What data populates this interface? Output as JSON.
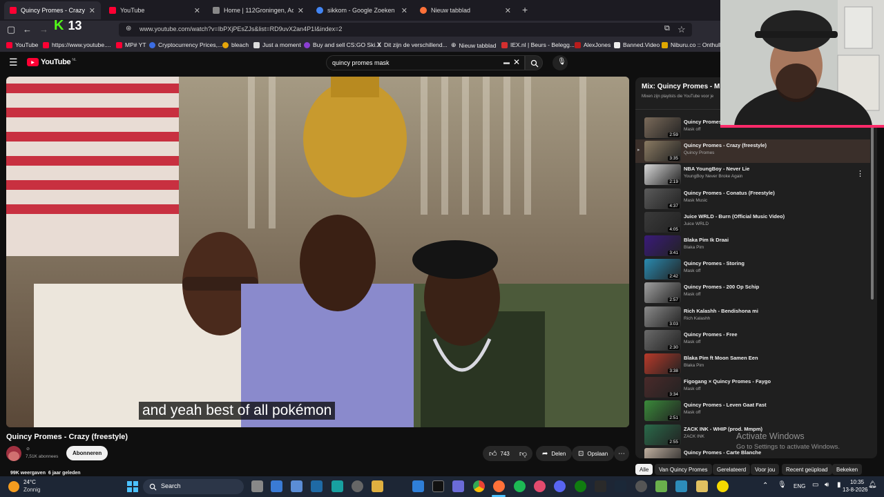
{
  "browser": {
    "tabs": [
      {
        "label": "Quincy Promes - Crazy (freestyle)",
        "active": true,
        "color": "#ff0033"
      },
      {
        "label": "YouTube",
        "active": false,
        "color": "#ff0033"
      },
      {
        "label": "Home | 112Groningen, Actueel",
        "active": false,
        "color": "#888888"
      },
      {
        "label": "sikkom - Google Zoeken",
        "active": false,
        "color": "#4285f4"
      },
      {
        "label": "Nieuw tabblad",
        "active": false,
        "color": "#ff7139"
      }
    ],
    "url": "www.youtube.com/watch?v=IbPXjPEsZJs&list=RD9uvX2an4P1I&index=2",
    "badge_number": "13",
    "bookmarks": [
      {
        "label": "YouTube",
        "color": "#ff0033"
      },
      {
        "label": "https://www.youtube....",
        "color": "#ff0033"
      },
      {
        "label": "MP# YT",
        "color": "#ff0033"
      },
      {
        "label": "Cryptocurrency Prices,...",
        "color": "#3b6de3"
      },
      {
        "label": "bleach",
        "color": "#e5a50a"
      },
      {
        "label": "Just a moment",
        "color": "#dddddd"
      },
      {
        "label": "Buy and sell CS:GO Ski...",
        "color": "#8a3ed1"
      },
      {
        "label": "Dit zijn de verschillend...",
        "color": "#ffffff"
      },
      {
        "label": "Nieuw tabblad",
        "color": "#cccccc"
      },
      {
        "label": "IEX.nl | Beurs - Belegg...",
        "color": "#d32f2f"
      },
      {
        "label": "AlexJones",
        "color": "#b71c1c"
      },
      {
        "label": "Banned.Video",
        "color": "#eeeeee"
      },
      {
        "label": "Niburu.co :: Onthulle",
        "color": "#e0a800"
      }
    ]
  },
  "youtube": {
    "logo_text": "YouTube",
    "logo_region": "NL",
    "search_value": "quincy promes mask",
    "caption": "and yeah best of all pokémon",
    "video_title": "Quincy Promes - Crazy (freestyle)",
    "subscribers": "7,51K abonnees",
    "subscribe_label": "Abonneren",
    "likes": "743",
    "share_label": "Delen",
    "save_label": "Opslaan",
    "views_line": "99K weergaven  6 jaar geleden"
  },
  "playlist": {
    "title": "Mix: Quincy Promes - M",
    "subtitle": "Mixen zijn playlists die YouTube voor je",
    "items": [
      {
        "title": "Quincy Promes",
        "channel": "Mask off",
        "duration": "2:59",
        "color": "#7a6a5a",
        "current": false
      },
      {
        "title": "Quincy Promes - Crazy (freestyle)",
        "channel": "Quincy Promes",
        "duration": "3:35",
        "color": "#8a7a62",
        "current": true
      },
      {
        "title": "NBA YoungBoy - Never Lie",
        "channel": "YoungBoy Never Broke Again",
        "duration": "2:19",
        "color": "#d8d8d8",
        "current": false
      },
      {
        "title": "Quincy Promes - Conatus (Freestyle)",
        "channel": "Mask Music",
        "duration": "4:37",
        "color": "#5a5a5a",
        "current": false
      },
      {
        "title": "Juice WRLD - Burn (Official Music Video)",
        "channel": "Juice WRLD",
        "duration": "4:05",
        "color": "#3a3a3a",
        "current": false
      },
      {
        "title": "Blaka Pim Ik Draai",
        "channel": "Blaka Pim",
        "duration": "3:41",
        "color": "#3a1a7a",
        "current": false
      },
      {
        "title": "Quincy Promes - Storing",
        "channel": "Mask off",
        "duration": "2:42",
        "color": "#2a8ab0",
        "current": false
      },
      {
        "title": "Quincy Promes - 200 Op Schip",
        "channel": "Mask off",
        "duration": "2:57",
        "color": "#a0a0a0",
        "current": false
      },
      {
        "title": "Rich Kalashh - Bendishona mi",
        "channel": "Rich Kalashh",
        "duration": "3:03",
        "color": "#8a8a8a",
        "current": false
      },
      {
        "title": "Quincy Promes - Free",
        "channel": "Mask off",
        "duration": "2:30",
        "color": "#6a6a6a",
        "current": false
      },
      {
        "title": "Blaka Pim ft Moon Samen Een",
        "channel": "Blaka Pim",
        "duration": "3:38",
        "color": "#b83a2a",
        "current": false
      },
      {
        "title": "Figogang × Quincy Promes - Faygo",
        "channel": "Mask off",
        "duration": "3:34",
        "color": "#4a2a2a",
        "current": false
      },
      {
        "title": "Quincy Promes - Leven Gaat Fast",
        "channel": "Mask off",
        "duration": "2:51",
        "color": "#3a8a3a",
        "current": false
      },
      {
        "title": "ZACK INK - WHIP (prod. Mmpm)",
        "channel": "ZACK INK",
        "duration": "2:55",
        "color": "#2a6a4a",
        "current": false
      },
      {
        "title": "Quincy Promes - Carte Blanche",
        "channel": "",
        "duration": "",
        "color": "#c0b0a0",
        "current": false
      }
    ],
    "chips": [
      "Alle",
      "Van Quincy Promes",
      "Gerelateerd",
      "Voor jou",
      "Recent geüpload",
      "Bekeken"
    ]
  },
  "watermark": {
    "line1": "Activate Windows",
    "line2": "Go to Settings to activate Windows."
  },
  "taskbar": {
    "weather_temp": "24°C",
    "weather_desc": "Zonnig",
    "search_label": "Search",
    "language": "ENG",
    "time": "10:35",
    "date": "13-8-2026"
  }
}
